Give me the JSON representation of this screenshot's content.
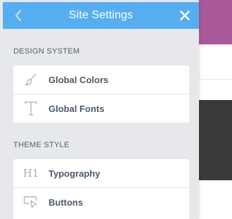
{
  "panel": {
    "title": "Site Settings",
    "back_icon": "chevron-left-icon",
    "close_icon": "close-icon"
  },
  "sections": [
    {
      "title": "DESIGN SYSTEM",
      "items": [
        {
          "label": "Global Colors",
          "icon": "brush-icon"
        },
        {
          "label": "Global Fonts",
          "icon": "font-t-icon"
        }
      ]
    },
    {
      "title": "THEME STYLE",
      "items": [
        {
          "label": "Typography",
          "icon": "heading-h1-icon",
          "icon_text": "H1"
        },
        {
          "label": "Buttons",
          "icon": "cursor-button-icon"
        }
      ]
    }
  ],
  "colors": {
    "header": "#56aef0",
    "panel_bg": "#e6e8ec",
    "card_bg": "#ffffff",
    "label": "#4e5a66",
    "icon": "#a4afb7",
    "bg_accent": "#a9599a",
    "bg_dark": "#3a3a3a"
  }
}
